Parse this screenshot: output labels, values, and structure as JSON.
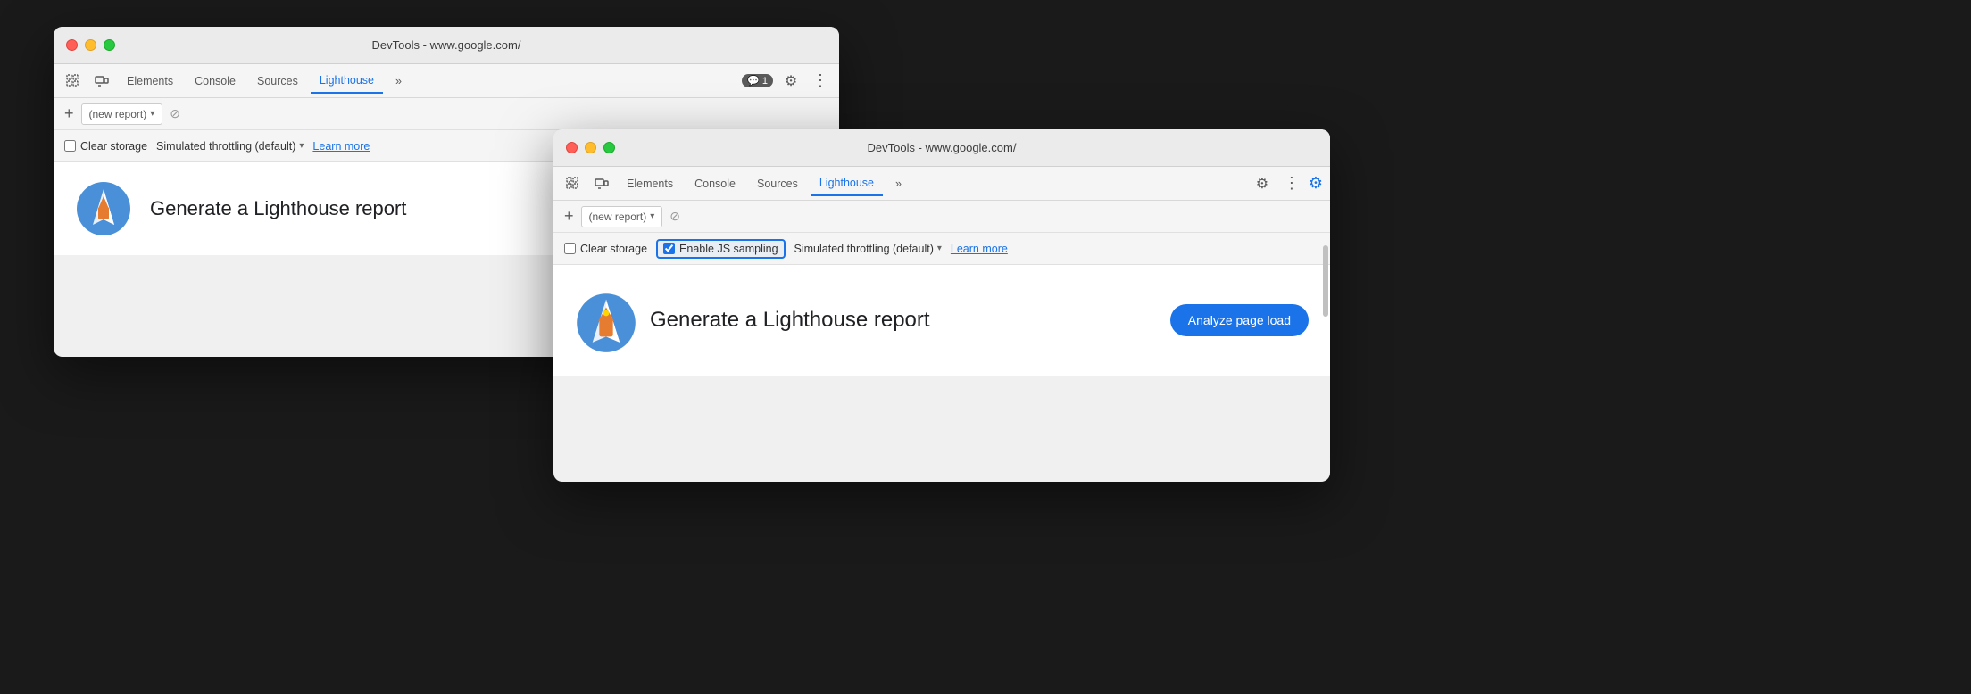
{
  "window_back": {
    "title": "DevTools - www.google.com/",
    "tabs": [
      {
        "label": "Elements",
        "active": false
      },
      {
        "label": "Console",
        "active": false
      },
      {
        "label": "Sources",
        "active": false
      },
      {
        "label": "Lighthouse",
        "active": true
      },
      {
        "label": "»",
        "active": false
      }
    ],
    "toolbar_right": {
      "badge_icon": "💬",
      "badge_count": "1"
    },
    "sub_toolbar": {
      "new_report_placeholder": "(new report)"
    },
    "options": {
      "clear_storage": "Clear storage",
      "throttling": "Simulated throttling (default)",
      "learn_more": "Learn more"
    },
    "main": {
      "generate_title": "Generate a Lighthouse report"
    }
  },
  "window_front": {
    "title": "DevTools - www.google.com/",
    "tabs": [
      {
        "label": "Elements",
        "active": false
      },
      {
        "label": "Console",
        "active": false
      },
      {
        "label": "Sources",
        "active": false
      },
      {
        "label": "Lighthouse",
        "active": true
      },
      {
        "label": "»",
        "active": false
      }
    ],
    "sub_toolbar": {
      "new_report_placeholder": "(new report)"
    },
    "options": {
      "clear_storage": "Clear storage",
      "enable_js_sampling": "Enable JS sampling",
      "throttling": "Simulated throttling (default)",
      "learn_more": "Learn more"
    },
    "main": {
      "generate_title": "Generate a Lighthouse report",
      "analyze_btn": "Analyze page load"
    }
  },
  "arrow": {
    "color": "#1a6fe8"
  }
}
